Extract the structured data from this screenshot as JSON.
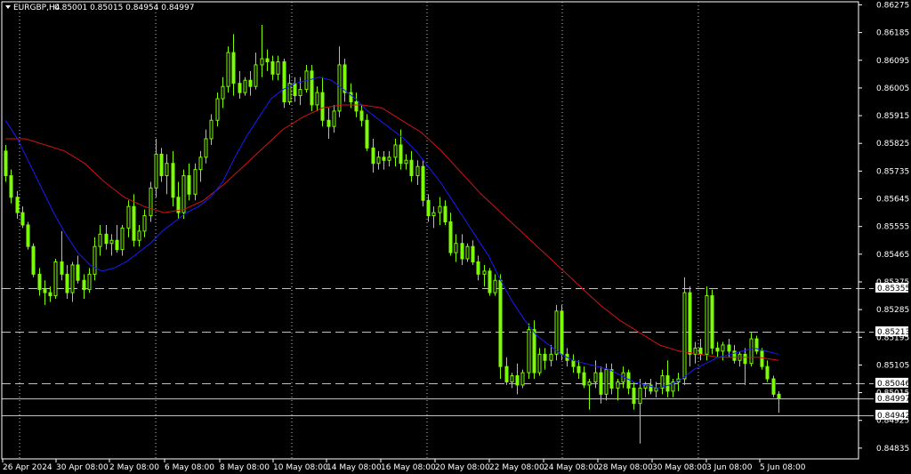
{
  "header": {
    "symbol": "EURGBP,H4",
    "ohlc": "0.85001 0.85015 0.84954 0.84997",
    "dropdown_icon": "triangle-down-icon"
  },
  "colors": {
    "background": "#000000",
    "candle": "#7CFC00",
    "ma_fast": "#1a1aff",
    "ma_slow": "#d11414",
    "grid": "#c0c0c0",
    "axis": "#ffffff",
    "level_line": "#c0c0c0",
    "price_box_bg": "#ffffff"
  },
  "price_axis": {
    "labels": [
      "0.86275",
      "0.86185",
      "0.86095",
      "0.86005",
      "0.85915",
      "0.85825",
      "0.85735",
      "0.85645",
      "0.85555",
      "0.85465",
      "0.85375",
      "0.85285",
      "0.85195",
      "0.85105",
      "0.85015",
      "0.84925",
      "0.84835"
    ],
    "marked": [
      "0.85355",
      "0.85213",
      "0.85046",
      "0.84997",
      "0.84942"
    ]
  },
  "time_axis": {
    "labels": [
      "26 Apr 2024",
      "30 Apr 08:00",
      "2 May 08:00",
      "6 May 08:00",
      "8 May 08:00",
      "10 May 08:00",
      "14 May 08:00",
      "16 May 08:00",
      "20 May 08:00",
      "22 May 08:00",
      "24 May 08:00",
      "28 May 08:00",
      "30 May 08:00",
      "3 Jun 08:00",
      "5 Jun 08:00"
    ]
  },
  "chart_data": {
    "type": "candlestick",
    "title": "EURGBP,H4",
    "ylim": [
      0.848,
      0.86285
    ],
    "grid": true,
    "horizontal_levels": [
      {
        "value": 0.85355,
        "style": "dashed"
      },
      {
        "value": 0.85213,
        "style": "dashed"
      },
      {
        "value": 0.85046,
        "style": "dashed"
      },
      {
        "value": 0.84997,
        "style": "solid"
      },
      {
        "value": 0.84942,
        "style": "solid"
      }
    ],
    "candles": [
      [
        0.858,
        0.8582,
        0.857,
        0.8572
      ],
      [
        0.8572,
        0.8574,
        0.8563,
        0.8565
      ],
      [
        0.8565,
        0.8567,
        0.8558,
        0.856
      ],
      [
        0.856,
        0.8562,
        0.8555,
        0.8556
      ],
      [
        0.8556,
        0.8557,
        0.8548,
        0.8549
      ],
      [
        0.8549,
        0.855,
        0.8539,
        0.854
      ],
      [
        0.854,
        0.8542,
        0.8533,
        0.8535
      ],
      [
        0.8535,
        0.8538,
        0.853,
        0.8534
      ],
      [
        0.8534,
        0.8536,
        0.8531,
        0.8533
      ],
      [
        0.8533,
        0.8545,
        0.8532,
        0.8544
      ],
      [
        0.8544,
        0.8554,
        0.8538,
        0.854
      ],
      [
        0.854,
        0.8543,
        0.8532,
        0.8534
      ],
      [
        0.8534,
        0.8544,
        0.8531,
        0.8543
      ],
      [
        0.8543,
        0.8546,
        0.8537,
        0.8538
      ],
      [
        0.8538,
        0.854,
        0.8532,
        0.8535
      ],
      [
        0.8535,
        0.8542,
        0.8534,
        0.854
      ],
      [
        0.854,
        0.8552,
        0.8538,
        0.8549
      ],
      [
        0.8549,
        0.8556,
        0.8546,
        0.8553
      ],
      [
        0.8553,
        0.8556,
        0.8548,
        0.855
      ],
      [
        0.855,
        0.8553,
        0.8546,
        0.8551
      ],
      [
        0.8551,
        0.8556,
        0.8547,
        0.8548
      ],
      [
        0.8548,
        0.8556,
        0.8546,
        0.8555
      ],
      [
        0.8555,
        0.8564,
        0.8552,
        0.8562
      ],
      [
        0.8562,
        0.8566,
        0.8549,
        0.8551
      ],
      [
        0.8551,
        0.8556,
        0.8549,
        0.8554
      ],
      [
        0.8554,
        0.8561,
        0.8552,
        0.8559
      ],
      [
        0.8559,
        0.857,
        0.8557,
        0.8568
      ],
      [
        0.8568,
        0.8584,
        0.8565,
        0.8579
      ],
      [
        0.8579,
        0.8581,
        0.857,
        0.8572
      ],
      [
        0.8572,
        0.8579,
        0.8566,
        0.8576
      ],
      [
        0.8576,
        0.858,
        0.8562,
        0.8565
      ],
      [
        0.8565,
        0.857,
        0.8558,
        0.856
      ],
      [
        0.856,
        0.8574,
        0.8558,
        0.8572
      ],
      [
        0.8572,
        0.8576,
        0.8564,
        0.8566
      ],
      [
        0.8566,
        0.8576,
        0.8564,
        0.8574
      ],
      [
        0.8574,
        0.858,
        0.857,
        0.8578
      ],
      [
        0.8578,
        0.8587,
        0.8576,
        0.8584
      ],
      [
        0.8584,
        0.8592,
        0.8582,
        0.859
      ],
      [
        0.859,
        0.8599,
        0.8588,
        0.8597
      ],
      [
        0.8597,
        0.8604,
        0.8594,
        0.8601
      ],
      [
        0.8601,
        0.8614,
        0.8599,
        0.8612
      ],
      [
        0.8612,
        0.8618,
        0.8598,
        0.8602
      ],
      [
        0.8602,
        0.8606,
        0.8597,
        0.8599
      ],
      [
        0.8599,
        0.8604,
        0.8598,
        0.8603
      ],
      [
        0.8603,
        0.8606,
        0.8598,
        0.8601
      ],
      [
        0.8601,
        0.8612,
        0.86,
        0.8608
      ],
      [
        0.8608,
        0.8621,
        0.8604,
        0.861
      ],
      [
        0.861,
        0.8613,
        0.8606,
        0.8609
      ],
      [
        0.8609,
        0.8611,
        0.8603,
        0.8605
      ],
      [
        0.8605,
        0.8611,
        0.8603,
        0.8609
      ],
      [
        0.8609,
        0.861,
        0.8594,
        0.8596
      ],
      [
        0.8596,
        0.8605,
        0.8595,
        0.8602
      ],
      [
        0.8602,
        0.8604,
        0.8596,
        0.8598
      ],
      [
        0.8598,
        0.8604,
        0.8595,
        0.86
      ],
      [
        0.86,
        0.8608,
        0.8599,
        0.8606
      ],
      [
        0.8606,
        0.8608,
        0.8593,
        0.8595
      ],
      [
        0.8595,
        0.8601,
        0.8593,
        0.8599
      ],
      [
        0.8599,
        0.8604,
        0.8588,
        0.859
      ],
      [
        0.859,
        0.8594,
        0.8584,
        0.8588
      ],
      [
        0.8588,
        0.8595,
        0.8586,
        0.8593
      ],
      [
        0.8593,
        0.8614,
        0.8591,
        0.8608
      ],
      [
        0.8608,
        0.861,
        0.8596,
        0.8599
      ],
      [
        0.8599,
        0.8602,
        0.8594,
        0.8596
      ],
      [
        0.8596,
        0.8599,
        0.8591,
        0.8593
      ],
      [
        0.8593,
        0.8595,
        0.8588,
        0.859
      ],
      [
        0.859,
        0.8592,
        0.858,
        0.8581
      ],
      [
        0.8581,
        0.8584,
        0.8573,
        0.8576
      ],
      [
        0.8576,
        0.858,
        0.8574,
        0.8578
      ],
      [
        0.8578,
        0.858,
        0.8574,
        0.8577
      ],
      [
        0.8577,
        0.858,
        0.8575,
        0.8578
      ],
      [
        0.8578,
        0.8584,
        0.8575,
        0.8582
      ],
      [
        0.8582,
        0.8587,
        0.8574,
        0.8576
      ],
      [
        0.8576,
        0.8579,
        0.8574,
        0.8577
      ],
      [
        0.8577,
        0.858,
        0.857,
        0.8572
      ],
      [
        0.8572,
        0.8577,
        0.8569,
        0.8575
      ],
      [
        0.8575,
        0.8577,
        0.8562,
        0.8564
      ],
      [
        0.8564,
        0.8566,
        0.8557,
        0.8559
      ],
      [
        0.8559,
        0.8562,
        0.8555,
        0.856
      ],
      [
        0.856,
        0.8565,
        0.8556,
        0.8562
      ],
      [
        0.8562,
        0.8564,
        0.8556,
        0.8557
      ],
      [
        0.8557,
        0.856,
        0.8546,
        0.8547
      ],
      [
        0.8547,
        0.8553,
        0.8544,
        0.855
      ],
      [
        0.855,
        0.8553,
        0.8543,
        0.8545
      ],
      [
        0.8545,
        0.855,
        0.8544,
        0.8549
      ],
      [
        0.8549,
        0.8551,
        0.8543,
        0.8544
      ],
      [
        0.8544,
        0.8546,
        0.8538,
        0.854
      ],
      [
        0.854,
        0.8543,
        0.8536,
        0.8541
      ],
      [
        0.8541,
        0.8542,
        0.8533,
        0.8534
      ],
      [
        0.8534,
        0.854,
        0.8533,
        0.8538
      ],
      [
        0.8538,
        0.854,
        0.8506,
        0.851
      ],
      [
        0.851,
        0.8513,
        0.8504,
        0.8505
      ],
      [
        0.8505,
        0.8508,
        0.8503,
        0.8507
      ],
      [
        0.8507,
        0.8511,
        0.8501,
        0.8504
      ],
      [
        0.8504,
        0.8509,
        0.8503,
        0.8508
      ],
      [
        0.8508,
        0.8524,
        0.8506,
        0.8522
      ],
      [
        0.8522,
        0.8525,
        0.8506,
        0.8508
      ],
      [
        0.8508,
        0.8516,
        0.8507,
        0.8514
      ],
      [
        0.8514,
        0.8516,
        0.8509,
        0.8512
      ],
      [
        0.8512,
        0.8517,
        0.851,
        0.8514
      ],
      [
        0.8514,
        0.853,
        0.8512,
        0.8528
      ],
      [
        0.8528,
        0.853,
        0.8512,
        0.8514
      ],
      [
        0.8514,
        0.8516,
        0.851,
        0.8512
      ],
      [
        0.8512,
        0.8514,
        0.8508,
        0.851
      ],
      [
        0.851,
        0.8512,
        0.8506,
        0.8508
      ],
      [
        0.8508,
        0.851,
        0.8503,
        0.8504
      ],
      [
        0.8504,
        0.8506,
        0.8496,
        0.8505
      ],
      [
        0.8505,
        0.8512,
        0.8503,
        0.8508
      ],
      [
        0.8508,
        0.851,
        0.8498,
        0.8501
      ],
      [
        0.8501,
        0.8511,
        0.8499,
        0.8509
      ],
      [
        0.8509,
        0.8511,
        0.8501,
        0.8503
      ],
      [
        0.8503,
        0.8506,
        0.8499,
        0.8505
      ],
      [
        0.8505,
        0.851,
        0.8503,
        0.8508
      ],
      [
        0.8508,
        0.8509,
        0.8501,
        0.8503
      ],
      [
        0.8503,
        0.8505,
        0.8496,
        0.8498
      ],
      [
        0.8498,
        0.8506,
        0.8485,
        0.8503
      ],
      [
        0.8503,
        0.8505,
        0.85,
        0.8504
      ],
      [
        0.8504,
        0.8506,
        0.8501,
        0.8502
      ],
      [
        0.8502,
        0.8505,
        0.85,
        0.8503
      ],
      [
        0.8503,
        0.8509,
        0.8501,
        0.8507
      ],
      [
        0.8507,
        0.8512,
        0.85,
        0.8502
      ],
      [
        0.8502,
        0.8506,
        0.85,
        0.8505
      ],
      [
        0.8505,
        0.8508,
        0.8502,
        0.8506
      ],
      [
        0.8506,
        0.8539,
        0.8504,
        0.8534
      ],
      [
        0.8534,
        0.8536,
        0.851,
        0.8514
      ],
      [
        0.8514,
        0.8518,
        0.8511,
        0.8516
      ],
      [
        0.8516,
        0.8519,
        0.8512,
        0.8514
      ],
      [
        0.8514,
        0.8536,
        0.8512,
        0.8533
      ],
      [
        0.8533,
        0.8535,
        0.8514,
        0.8516
      ],
      [
        0.8516,
        0.8518,
        0.8513,
        0.8515
      ],
      [
        0.8515,
        0.8518,
        0.8512,
        0.8517
      ],
      [
        0.8517,
        0.8519,
        0.8513,
        0.8515
      ],
      [
        0.8515,
        0.8517,
        0.8511,
        0.8512
      ],
      [
        0.8512,
        0.8515,
        0.851,
        0.8514
      ],
      [
        0.8514,
        0.8516,
        0.8504,
        0.8511
      ],
      [
        0.8511,
        0.8521,
        0.851,
        0.8519
      ],
      [
        0.8519,
        0.852,
        0.8514,
        0.8515
      ],
      [
        0.8515,
        0.8516,
        0.8509,
        0.851
      ],
      [
        0.851,
        0.8512,
        0.8505,
        0.8506
      ],
      [
        0.8506,
        0.8507,
        0.85,
        0.8501
      ],
      [
        0.8501,
        0.8502,
        0.8495,
        0.84997
      ]
    ],
    "ma_fast": [
      0.859,
      0.8584,
      0.8576,
      0.8568,
      0.856,
      0.8553,
      0.8547,
      0.8543,
      0.8541,
      0.8542,
      0.8544,
      0.8547,
      0.855,
      0.8554,
      0.8557,
      0.856,
      0.8562,
      0.8565,
      0.857,
      0.8578,
      0.8585,
      0.8591,
      0.8597,
      0.86,
      0.8602,
      0.8603,
      0.8604,
      0.8603,
      0.86,
      0.8597,
      0.8593,
      0.859,
      0.8587,
      0.8584,
      0.858,
      0.8575,
      0.857,
      0.8564,
      0.8558,
      0.8552,
      0.8546,
      0.8538,
      0.8531,
      0.8525,
      0.852,
      0.8517,
      0.8514,
      0.8512,
      0.8511,
      0.851,
      0.8509,
      0.8507,
      0.8505,
      0.8504,
      0.8503,
      0.8504,
      0.8506,
      0.8509,
      0.8511,
      0.8513,
      0.8514,
      0.8515,
      0.8516,
      0.8515,
      0.8514
    ],
    "ma_slow": [
      0.8584,
      0.8584,
      0.8582,
      0.858,
      0.8576,
      0.857,
      0.8565,
      0.8562,
      0.856,
      0.8561,
      0.8564,
      0.8569,
      0.8575,
      0.8581,
      0.8587,
      0.8591,
      0.8594,
      0.8595,
      0.8595,
      0.8594,
      0.859,
      0.8586,
      0.858,
      0.8573,
      0.8566,
      0.856,
      0.8554,
      0.8548,
      0.8542,
      0.8536,
      0.853,
      0.8525,
      0.8521,
      0.8517,
      0.8515,
      0.8514,
      0.8513,
      0.8513,
      0.8513,
      0.8512
    ]
  }
}
